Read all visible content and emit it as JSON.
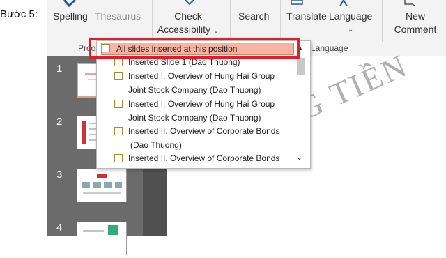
{
  "step_label": "Bước 5:",
  "ribbon": {
    "spelling": "Spelling",
    "thesaurus": "Thesaurus",
    "check_line1": "Check",
    "check_line2": "Accessibility",
    "search": "Search",
    "translate": "Translate",
    "language": "Language",
    "new_line1": "New",
    "new_line2": "Comment",
    "group_proofing": "Proo",
    "group_language": "Language",
    "chevron": "⌄"
  },
  "slides": {
    "numbers": [
      "1",
      "2",
      "3",
      "4"
    ]
  },
  "dropdown": {
    "header": "All slides inserted at this position",
    "items": [
      "Inserted Slide 1 (Dao Thuong)",
      "Inserted I. Overview of Hung Hai Group",
      "Joint Stock Company  (Dao Thuong)",
      "Inserted I. Overview of Hung Hai Group",
      "Joint Stock Company  (Dao Thuong)",
      "Inserted II. Overview of Corporate Bonds",
      "(Dao Thuong)",
      "Inserted II. Overview of Corporate Bonds"
    ],
    "scroll_up": "▲",
    "scroll_down": "⌄"
  },
  "watermark": "ĐỒNG TIỀN",
  "colors": {
    "highlight": "#f9b3a1",
    "callout_border": "#e01e2b",
    "checkbox_border": "#a08f2f",
    "pane_bg": "#6b6b6b"
  }
}
